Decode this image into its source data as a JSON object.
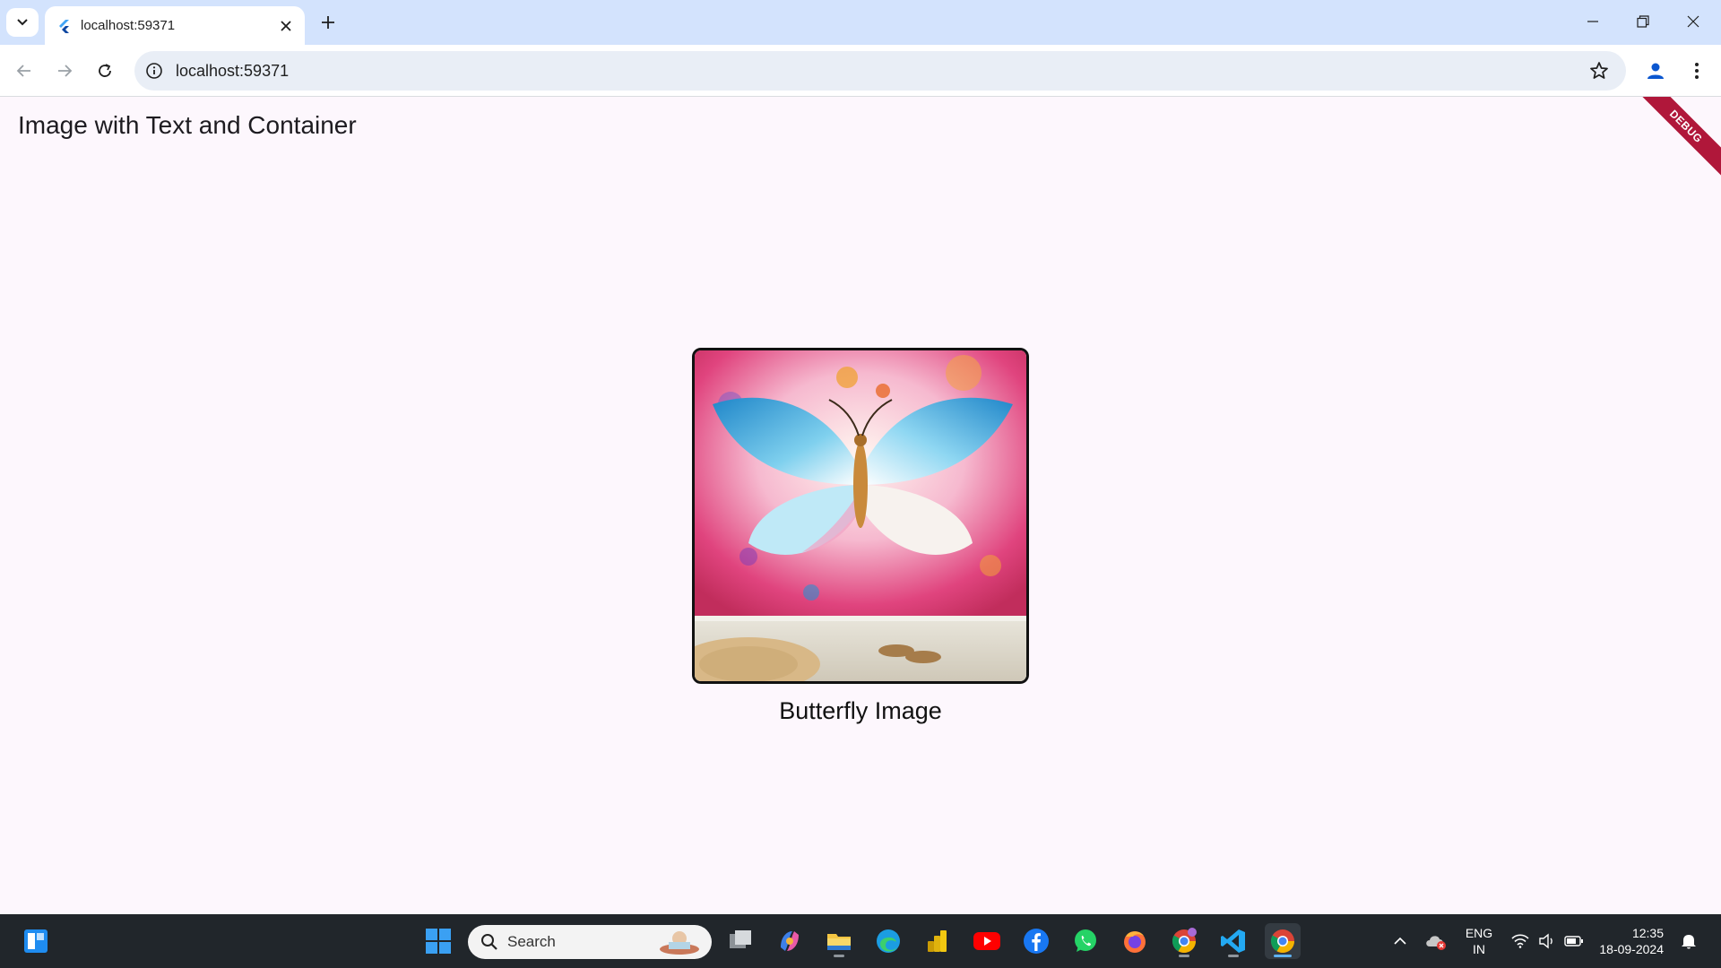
{
  "browser": {
    "tab_title": "localhost:59371",
    "url": "localhost:59371"
  },
  "page": {
    "app_title": "Image with Text and Container",
    "debug_badge": "DEBUG",
    "image_caption": "Butterfly Image"
  },
  "taskbar": {
    "search_placeholder": "Search",
    "language": "ENG",
    "region": "IN",
    "time": "12:35",
    "date": "18-09-2024"
  },
  "colors": {
    "tabstrip": "#d3e3fd",
    "page_background": "#fdf7fd",
    "debug_ribbon": "#b0173a",
    "taskbar": "#21262b"
  }
}
